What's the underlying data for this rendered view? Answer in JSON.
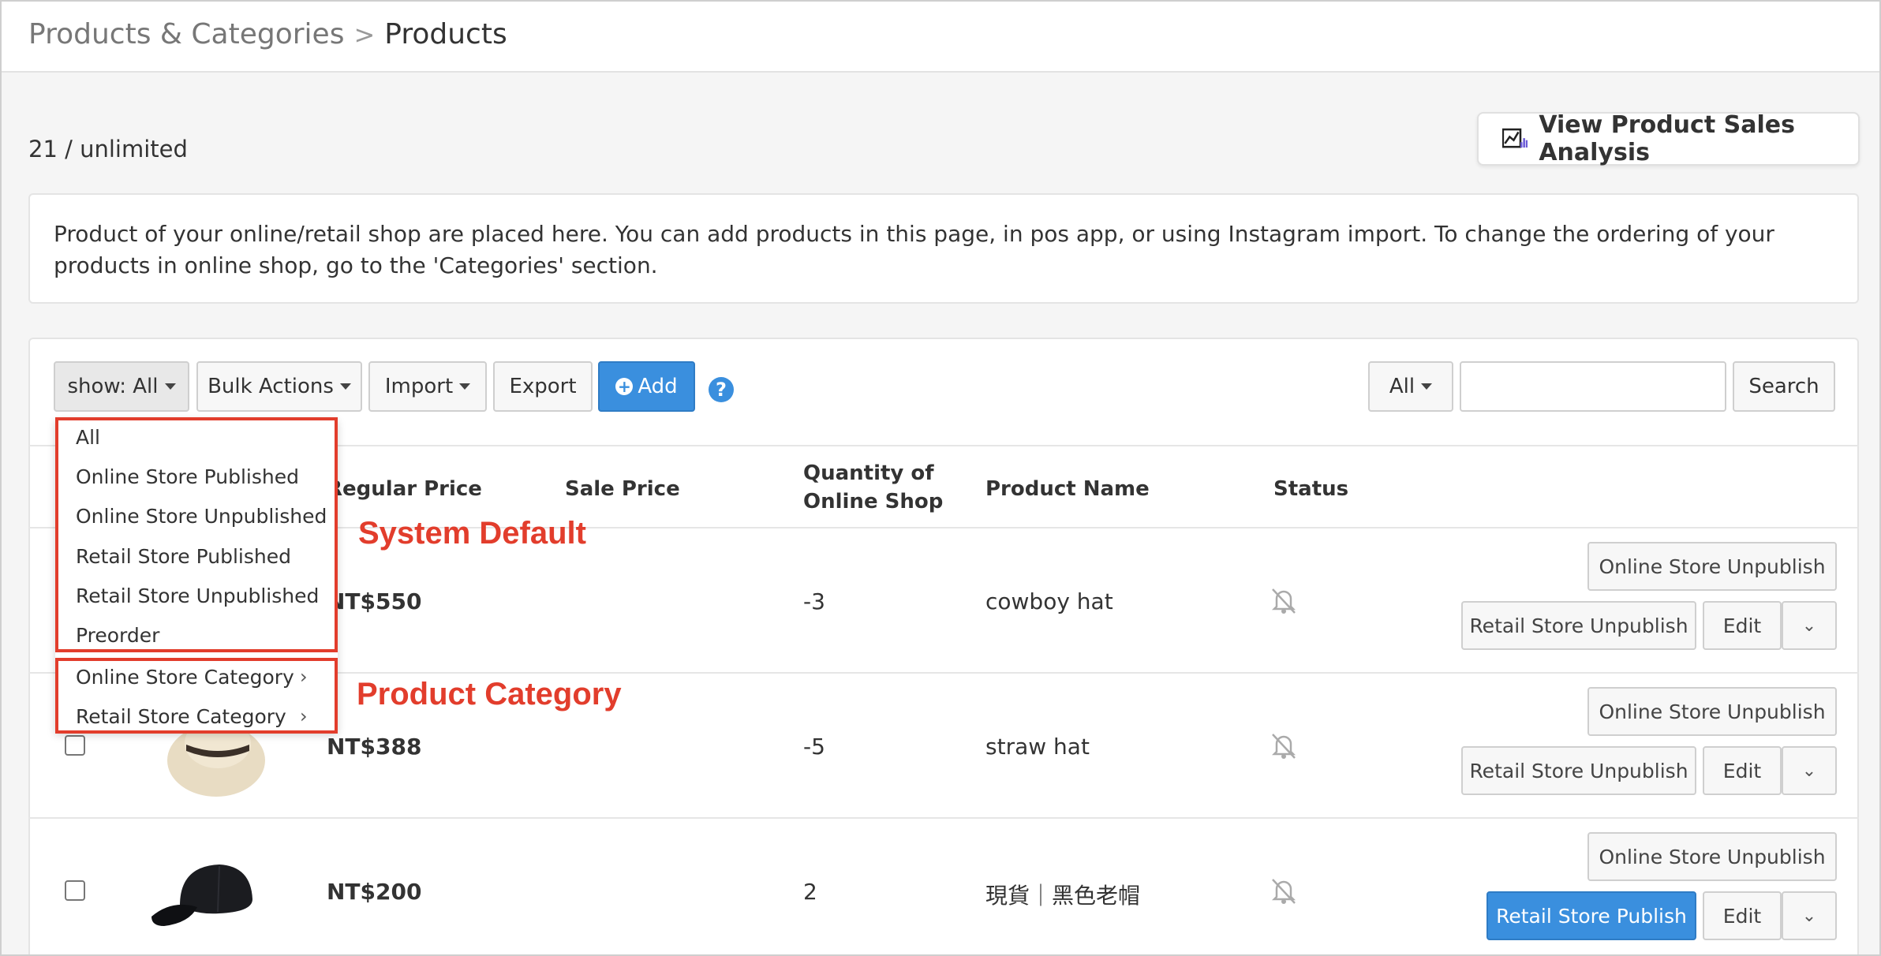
{
  "breadcrumb": {
    "parent": "Products & Categories",
    "separator": ">",
    "current": "Products"
  },
  "quota": "21 / unlimited",
  "analysis_button": "View Product Sales Analysis",
  "info_text": "Product of your online/retail shop are placed here. You can add products in this page, in pos app, or using Instagram import. To change the ordering of your products in online shop, go to the 'Categories' section.",
  "toolbar": {
    "show_label": "show: All",
    "bulk_label": "Bulk Actions",
    "import_label": "Import",
    "export_label": "Export",
    "add_label": "Add",
    "filter_label": "All",
    "search_value": "",
    "search_label": "Search"
  },
  "dropdown": {
    "system_items": [
      "All",
      "Online Store Published",
      "Online Store Unpublished",
      "Retail Store Published",
      "Retail Store Unpublished",
      "Preorder"
    ],
    "category_items": [
      "Online Store Category",
      "Retail Store Category"
    ]
  },
  "annotations": {
    "system_default": "System Default",
    "product_category": "Product Category"
  },
  "table": {
    "headers": {
      "regular_price": "Regular Price",
      "sale_price": "Sale Price",
      "quantity_line1": "Quantity of",
      "quantity_line2": "Online Shop",
      "product_name": "Product Name",
      "status": "Status"
    },
    "rows": [
      {
        "regular_price": "NT$550",
        "quantity": "-3",
        "name": "cowboy hat",
        "online_btn": "Online Store Unpublish",
        "retail_btn": "Retail Store Unpublish",
        "edit": "Edit"
      },
      {
        "regular_price": "NT$388",
        "quantity": "-5",
        "name": "straw hat",
        "online_btn": "Online Store Unpublish",
        "retail_btn": "Retail Store Unpublish",
        "edit": "Edit"
      },
      {
        "regular_price": "NT$200",
        "quantity": "2",
        "name": "現貨｜黑色老帽",
        "online_btn": "Online Store Unpublish",
        "retail_btn": "Retail Store Publish",
        "edit": "Edit"
      }
    ]
  },
  "colors": {
    "primary": "#3a8fde",
    "annotation": "#e23d2c"
  },
  "icons": {
    "analysis": "chart-icon",
    "add": "plus-circle-icon",
    "help": "question-icon",
    "status": "bell-slash-icon",
    "row_menu": "chevron-down-icon"
  }
}
